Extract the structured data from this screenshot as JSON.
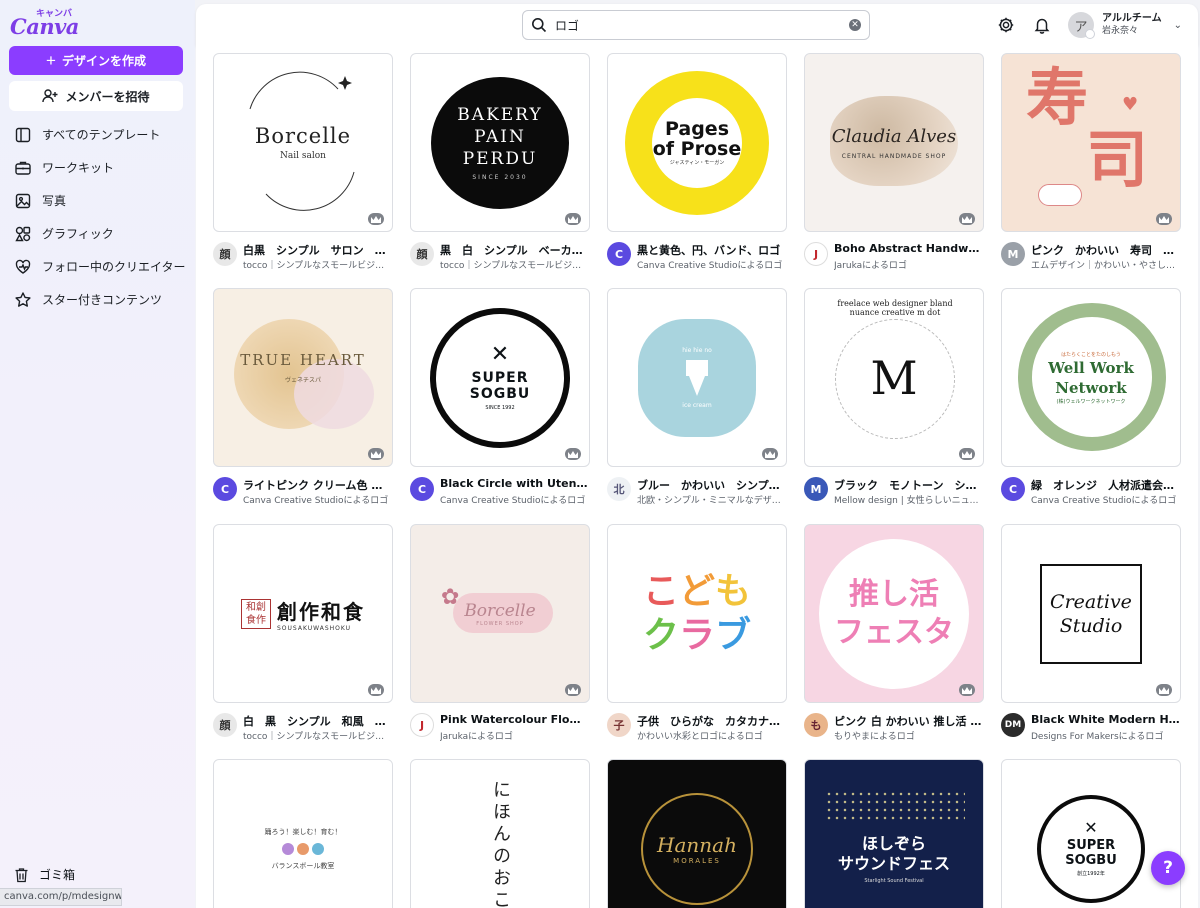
{
  "app": {
    "brand": "Canva",
    "brand_kana": "キャンバ",
    "create_label": "デザインを作成",
    "invite_label": "メンバーを招待",
    "accent": "#8b3dff"
  },
  "sidebar": {
    "items": [
      {
        "label": "すべてのテンプレート",
        "icon": "template-icon"
      },
      {
        "label": "ワークキット",
        "icon": "briefcase-icon"
      },
      {
        "label": "写真",
        "icon": "photo-icon"
      },
      {
        "label": "グラフィック",
        "icon": "shapes-icon"
      },
      {
        "label": "フォロー中のクリエイター",
        "icon": "heart-icon"
      },
      {
        "label": "スター付きコンテンツ",
        "icon": "star-icon"
      }
    ],
    "trash_label": "ゴミ箱",
    "status_url": "canva.com/p/mdesignworks/"
  },
  "header": {
    "search_value": "ロゴ",
    "team": "アルルチーム",
    "user": "岩永奈々",
    "avatar_initial": "ア"
  },
  "thumbs": {
    "t1": {
      "main": "Borcelle",
      "sub": "Nail salon"
    },
    "t2": {
      "l1": "BAKERY",
      "l2": "PAIN",
      "l3": "PERDU",
      "sub": "SINCE 2030"
    },
    "t3": {
      "l1": "Pages",
      "l2": "of Prose",
      "sub": "ジャスティン・モーガン"
    },
    "t4": {
      "main": "Claudia Alves",
      "sub": "CENTRAL HANDMADE SHOP"
    },
    "t5": {
      "l1": "寿",
      "l2": "司"
    },
    "t6": {
      "main": "TRUE HEART",
      "sub": "ヴェネチスパ"
    },
    "t7": {
      "l1": "SUPER",
      "l2": "SOGBU",
      "sub": "SINCE 1992"
    },
    "t8": {
      "top": "hie hie no",
      "bottom": "ice cream"
    },
    "t9": {
      "ring": "freelace web designer bland nuance creative m dot",
      "mark": "M"
    },
    "t10": {
      "small": "はたらくことをたのしもう",
      "l1": "Well Work",
      "l2": "Network",
      "sub": "(株)ウェルワークネットワーク"
    },
    "t11": {
      "seal": "和創食作",
      "main": "創作和食",
      "sub": "SOUSAKUWASHOKU"
    },
    "t12": {
      "main": "Borcelle",
      "sub": "FLOWER SHOP"
    },
    "t13": {
      "l1": "こども",
      "l2": "クラブ"
    },
    "t14": {
      "l1": "推し活",
      "l2": "フェスタ"
    },
    "t15": {
      "l1": "Creative",
      "l2": "Studio"
    },
    "t16": {
      "arc": "踊ろう！楽しむ！育む！",
      "sub": "バランスボール教室"
    },
    "t17": {
      "main": "にほんのおこ"
    },
    "t18": {
      "main": "Hannah",
      "sub": "MORALES"
    },
    "t19": {
      "l1": "ほしぞら",
      "l2": "サウンドフェス",
      "sub": "Starlight Sound Festival"
    },
    "t20": {
      "l1": "SUPER",
      "l2": "SOGBU",
      "sub": "創立1992年"
    }
  },
  "cards": [
    {
      "title": "白黒　シンプル　サロン　ロゴ",
      "sub": "tocco｜シンプルなスモールビジネ…",
      "av": "顔"
    },
    {
      "title": "黒　白　シンプル　ベーカリ…",
      "sub": "tocco｜シンプルなスモールビジネ…",
      "av": "顔"
    },
    {
      "title": "黒と黄色、円、バンド、ロゴ",
      "sub": "Canva Creative Studioによるロゴ",
      "av": "C"
    },
    {
      "title": "Boho Abstract Handwritten…",
      "sub": "Jarukaによるロゴ",
      "av": "J"
    },
    {
      "title": "ピンク　かわいい　寿司　日…",
      "sub": "エムデザイン｜かわいい・やさし…",
      "av": "M"
    },
    {
      "title": "ライトピンク クリーム色 黄…",
      "sub": "Canva Creative Studioによるロゴ",
      "av": "C"
    },
    {
      "title": "Black Circle with Utensils R…",
      "sub": "Canva Creative Studioによるロゴ",
      "av": "C"
    },
    {
      "title": "ブルー　かわいい　シンプル…",
      "sub": "北欧・シンプル・ミニマルなデザ…",
      "av": "北"
    },
    {
      "title": "ブラック　モノトーン　シン…",
      "sub": "Mellow design | 女性らしいニュア…",
      "av": "M"
    },
    {
      "title": "緑　オレンジ　人材派遣会社…",
      "sub": "Canva Creative Studioによるロゴ",
      "av": "C"
    },
    {
      "title": "白　黒　シンプル　和風　飲…",
      "sub": "tocco｜シンプルなスモールビジネ…",
      "av": "顔"
    },
    {
      "title": "Pink Watercolour Flower Sh…",
      "sub": "Jarukaによるロゴ",
      "av": "J"
    },
    {
      "title": "子供　ひらがな　カタカナ　…",
      "sub": "かわいい水彩とロゴによるロゴ",
      "av": "子"
    },
    {
      "title": "ピンク 白 かわいい 推し活 ロゴ",
      "sub": "もりやまによるロゴ",
      "av": "も"
    },
    {
      "title": "Black White Modern Handw…",
      "sub": "Designs For Makersによるロゴ",
      "av": "DM"
    }
  ],
  "help_label": "?"
}
